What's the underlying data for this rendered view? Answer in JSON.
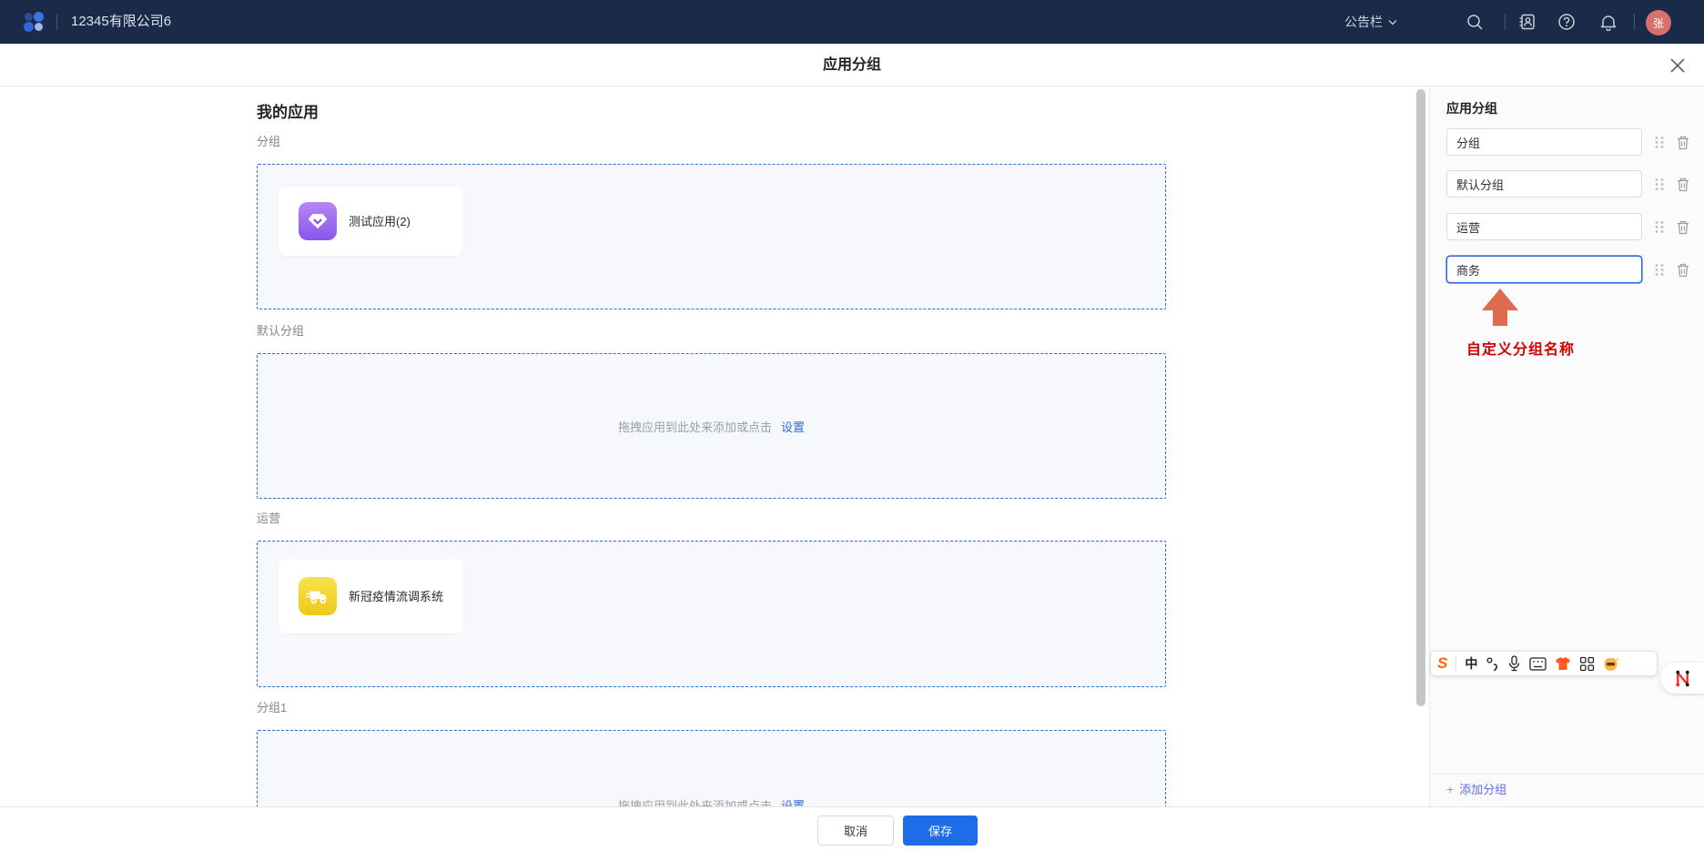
{
  "topbar": {
    "company": "12345有限公司6",
    "announcement_label": "公告栏",
    "avatar_initial": "张"
  },
  "header": {
    "title": "应用分组"
  },
  "main": {
    "my_apps_title": "我的应用",
    "empty_text": "拖拽应用到此处来添加或点击",
    "empty_link": "设置",
    "groups": [
      {
        "label": "分组",
        "apps": [
          {
            "name": "测试应用(2)",
            "icon": "gem-icon",
            "color": "purple"
          }
        ]
      },
      {
        "label": "默认分组",
        "apps": []
      },
      {
        "label": "运营",
        "apps": [
          {
            "name": "新冠疫情流调系统",
            "icon": "truck-icon",
            "color": "yellow"
          }
        ]
      },
      {
        "label": "分组1",
        "apps": []
      }
    ]
  },
  "sidebar": {
    "title": "应用分组",
    "group_inputs": [
      {
        "value": "分组",
        "focused": false
      },
      {
        "value": "默认分组",
        "focused": false
      },
      {
        "value": "运营",
        "focused": false
      },
      {
        "value": "商务",
        "focused": true
      }
    ],
    "annotation": "自定义分组名称",
    "add_group_label": "添加分组",
    "add_group_plus": "+"
  },
  "ime": {
    "brand": "S",
    "mode": "中"
  },
  "footer": {
    "cancel": "取消",
    "save": "保存"
  },
  "colors": {
    "topbar_bg": "#1a2b4a",
    "accent_blue": "#2e6be0",
    "save_blue": "#1f6ce8",
    "arrow_coral": "#de6a50",
    "annotation_red": "#d40000",
    "purple_icon": [
      "#b588f2",
      "#8a55ec"
    ],
    "yellow_icon": [
      "#f8e34c",
      "#eec819"
    ],
    "avatar_bg": "#d9706d"
  }
}
